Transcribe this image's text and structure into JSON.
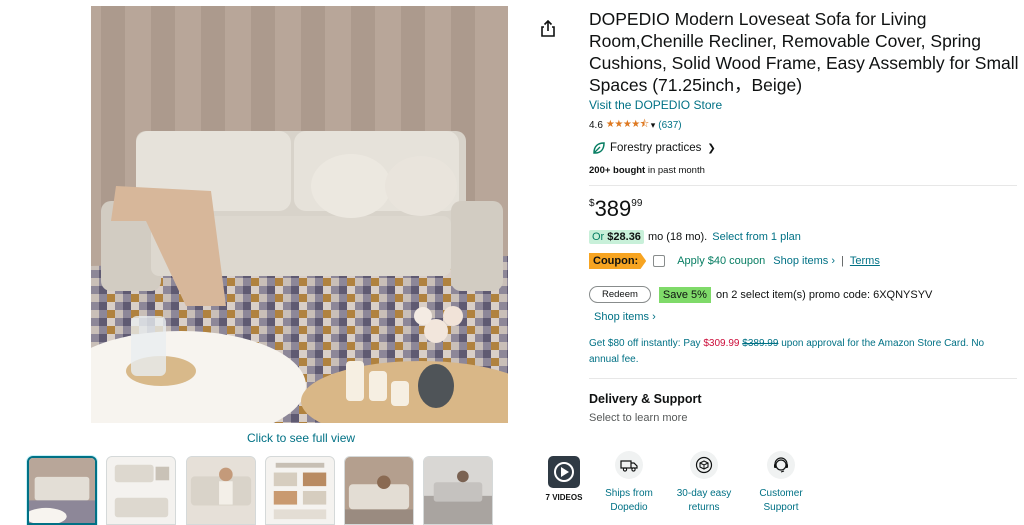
{
  "product": {
    "title": "DOPEDIO Modern Loveseat Sofa for Living Room,Chenille Recliner, Removable Cover, Spring Cushions, Solid Wood Frame, Easy Assembly for Small Spaces (71.25inch，Beige)",
    "store_link": "Visit the DOPEDIO Store",
    "rating_value": "4.6",
    "stars": "★★★★⯪",
    "rating_count": "(637)",
    "forestry_label": "Forestry practices",
    "bought_bold": "200+ bought",
    "bought_rest": " in past month"
  },
  "price": {
    "symbol": "$",
    "whole": "389",
    "fraction": "99"
  },
  "financing": {
    "or": "Or ",
    "amount": "$28.36",
    "term": "mo (18 mo).",
    "plan_link": "Select from 1 plan"
  },
  "coupon": {
    "badge": "Coupon:",
    "apply_text": "Apply $40 coupon",
    "shop_items": "Shop items ›",
    "separator": "|",
    "terms": "Terms"
  },
  "promo": {
    "redeem": "Redeem",
    "save_badge": "Save 5%",
    "text": "on 2 select item(s) promo code: 6XQNYSYV",
    "shop_items": "Shop items ›"
  },
  "card_offer": {
    "prefix": "Get $80 off instantly: Pay ",
    "new_price": "$309.99",
    "old_price": "$389.99",
    "suffix": " upon approval for the Amazon Store Card. No annual fee."
  },
  "delivery": {
    "title": "Delivery & Support",
    "subtitle": "Select to learn more",
    "items": [
      {
        "label": "Ships from Dopedio",
        "icon": "truck-icon"
      },
      {
        "label": "30-day easy returns",
        "icon": "returns-box-icon"
      },
      {
        "label": "Customer Support",
        "icon": "headset-icon"
      }
    ]
  },
  "gallery": {
    "full_view_link": "Click to see full view",
    "video_label": "7 VIDEOS",
    "thumb_count": 6
  },
  "colors": {
    "link": "#007185",
    "star": "#de7921",
    "coupon": "#f7a421",
    "save_green": "#7fda69",
    "finance_green": "#c8f0d9",
    "price_red": "#cc0c39"
  }
}
